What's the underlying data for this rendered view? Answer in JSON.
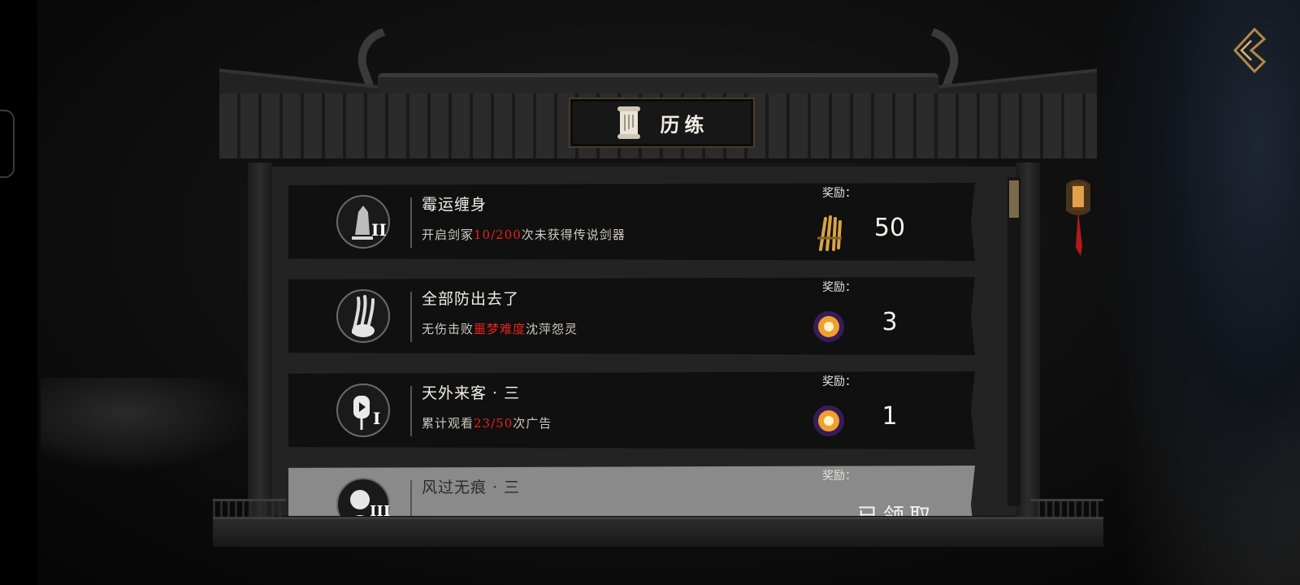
{
  "header": {
    "title": "历练"
  },
  "colors": {
    "highlight": "#e8221c",
    "row_bg": "#101010",
    "claimed_row_bg": "#8a8a8a",
    "panel_bg": "#232323"
  },
  "achievements": [
    {
      "title": "霉运缠身",
      "desc_before": "开启剑冢",
      "desc_highlight": "10/200",
      "desc_after": "次未获得传说剑器",
      "tier": "II",
      "icon": "crystal-icon",
      "reward_label": "奖励：",
      "reward_icon": "golden-swords-icon",
      "reward_qty": "50"
    },
    {
      "title": "全部防出去了",
      "desc_before": "无伤击败",
      "desc_highlight": "噩梦难度",
      "desc_after": "沈萍怨灵",
      "tier": "",
      "icon": "claw-icon",
      "reward_label": "奖励：",
      "reward_icon": "glowing-orb-icon",
      "reward_qty": "3"
    },
    {
      "title": "天外来客 · 三",
      "desc_before": "累计观看",
      "desc_highlight": "23/50",
      "desc_after": "次广告",
      "tier": "I",
      "icon": "video-lantern-icon",
      "reward_label": "奖励：",
      "reward_icon": "glowing-orb-icon",
      "reward_qty": "1"
    },
    {
      "title": "风过无痕 · 三",
      "reward_label": "奖励：",
      "tier": "III",
      "icon": "figure-icon",
      "claimed_text": "已领取"
    }
  ]
}
